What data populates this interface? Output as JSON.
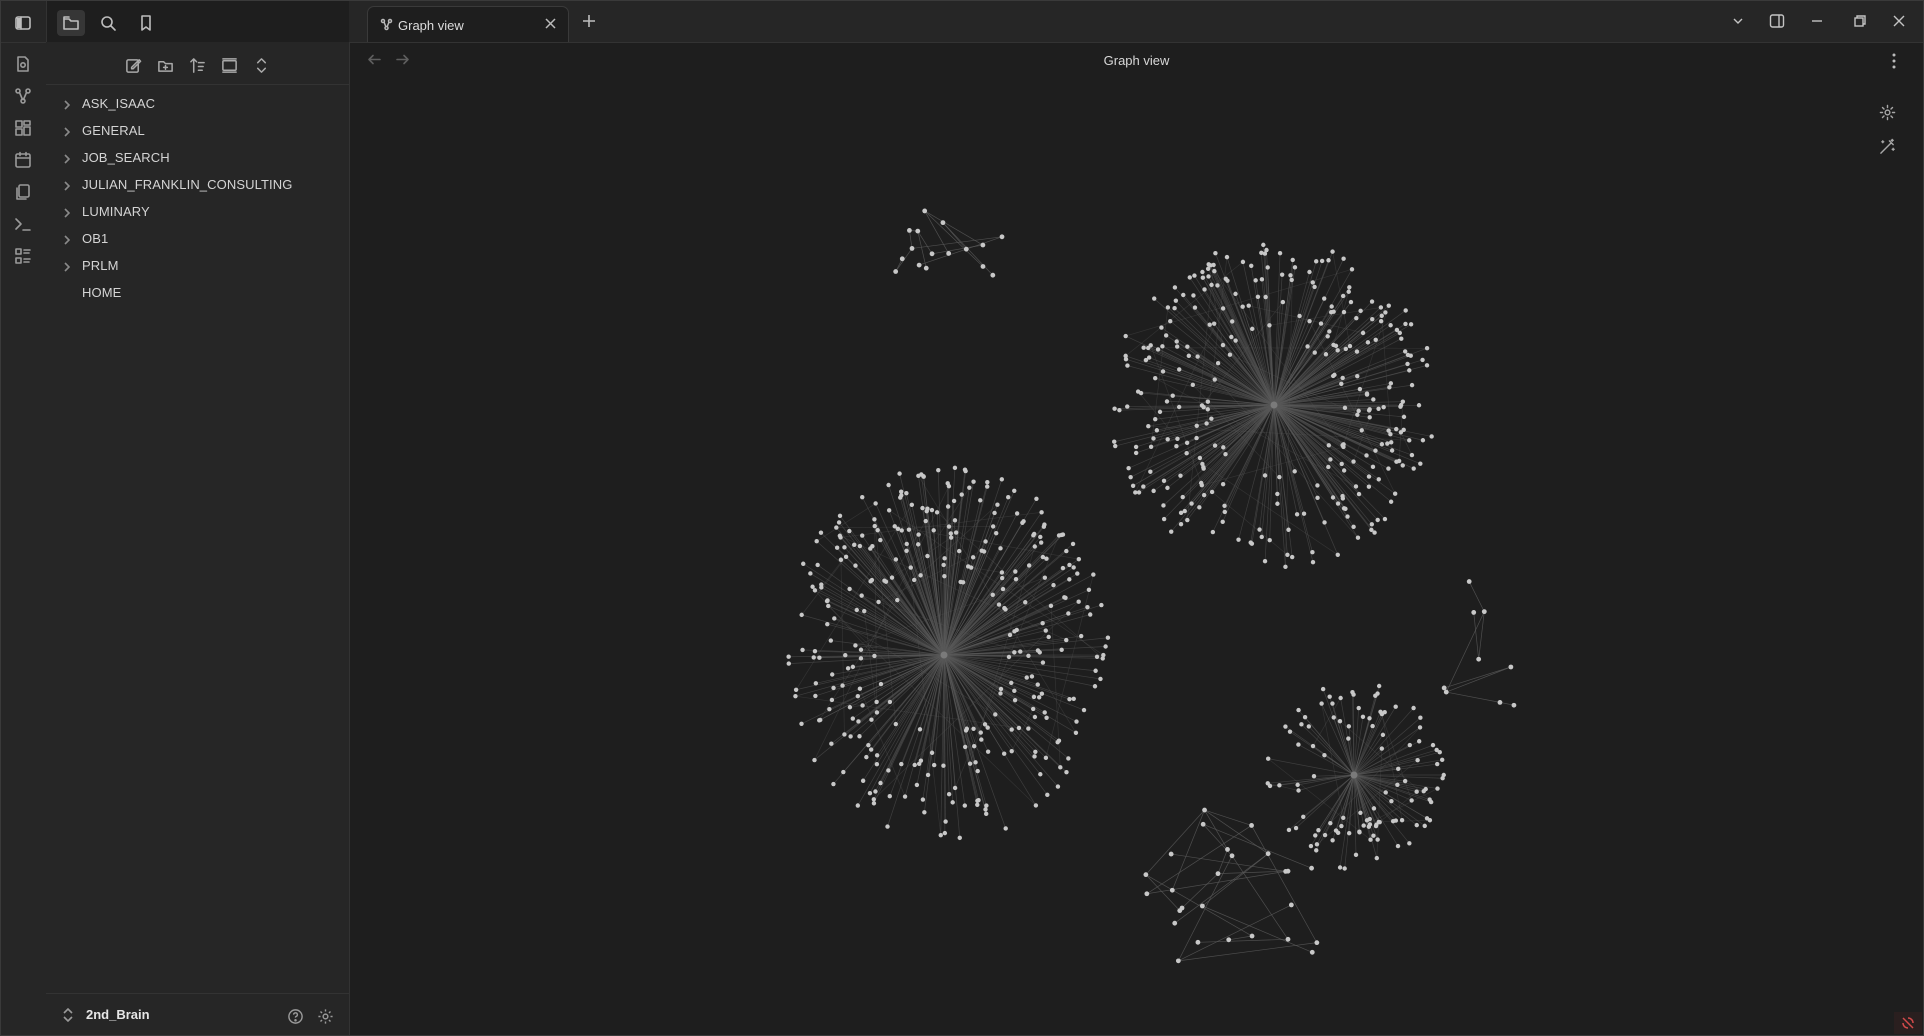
{
  "window": {
    "tab_title": "Graph view",
    "view_title": "Graph view"
  },
  "ribbon": {
    "icons": [
      "open-quick-switcher-icon",
      "graph-view-icon",
      "canvas-icon",
      "daily-notes-icon",
      "templates-icon",
      "command-palette-icon",
      "outline-icon"
    ]
  },
  "sidebar": {
    "top_icons": [
      "toggle-sidebar-icon",
      "files-icon",
      "search-icon",
      "bookmarks-icon"
    ],
    "nav_actions": [
      "new-note-icon",
      "new-folder-icon",
      "sort-order-icon",
      "auto-reveal-icon",
      "expand-collapse-icon"
    ],
    "items": [
      {
        "label": "ASK_ISAAC",
        "folder": true
      },
      {
        "label": "GENERAL",
        "folder": true
      },
      {
        "label": "JOB_SEARCH",
        "folder": true
      },
      {
        "label": "JULIAN_FRANKLIN_CONSULTING",
        "folder": true
      },
      {
        "label": "LUMINARY",
        "folder": true
      },
      {
        "label": "OB1",
        "folder": true
      },
      {
        "label": "PRLM",
        "folder": true
      },
      {
        "label": "HOME",
        "folder": false
      }
    ],
    "vault_name": "2nd_Brain"
  },
  "graph": {
    "colors": {
      "node": "#c8c8c8",
      "edge": "#5a5a5a",
      "background": "#1e1e1e"
    },
    "clusters": [
      {
        "id": "cluster-a",
        "nodes": 330
      },
      {
        "id": "cluster-b",
        "nodes": 310
      },
      {
        "id": "cluster-c",
        "nodes": 110
      },
      {
        "id": "cluster-d",
        "nodes": 16
      },
      {
        "id": "cluster-e",
        "nodes": 26
      },
      {
        "id": "cluster-f",
        "nodes": 9
      }
    ]
  }
}
